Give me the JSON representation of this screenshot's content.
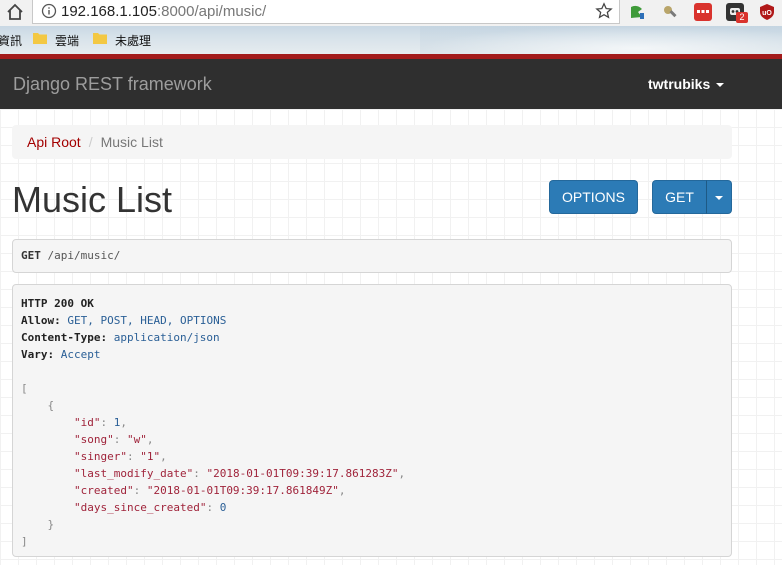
{
  "browser": {
    "url_host": "192.168.1.105",
    "url_rest": ":8000/api/music/",
    "extension_badge": "2",
    "bookmarks": [
      {
        "label": "資訊"
      },
      {
        "label": "雲端"
      },
      {
        "label": "未處理"
      }
    ]
  },
  "navbar": {
    "brand": "Django REST framework",
    "user": "twtrubiks"
  },
  "breadcrumb": {
    "root": "Api Root",
    "separator": "/",
    "current": "Music List"
  },
  "page": {
    "title": "Music List",
    "options_label": "OPTIONS",
    "get_label": "GET"
  },
  "request": {
    "method": "GET",
    "path": "/api/music/"
  },
  "response": {
    "status": "HTTP 200 OK",
    "headers": [
      {
        "key": "Allow:",
        "value": "GET, POST, HEAD, OPTIONS"
      },
      {
        "key": "Content-Type:",
        "value": "application/json"
      },
      {
        "key": "Vary:",
        "value": "Accept"
      }
    ],
    "body": {
      "open_bracket": "[",
      "open_brace": "{",
      "fields": [
        {
          "key": "\"id\"",
          "value": "1",
          "type": "num",
          "comma": ","
        },
        {
          "key": "\"song\"",
          "value": "\"w\"",
          "type": "str",
          "comma": ","
        },
        {
          "key": "\"singer\"",
          "value": "\"1\"",
          "type": "str",
          "comma": ","
        },
        {
          "key": "\"last_modify_date\"",
          "value": "\"2018-01-01T09:39:17.861283Z\"",
          "type": "str",
          "comma": ","
        },
        {
          "key": "\"created\"",
          "value": "\"2018-01-01T09:39:17.861849Z\"",
          "type": "str",
          "comma": ","
        },
        {
          "key": "\"days_since_created\"",
          "value": "0",
          "type": "num",
          "comma": ""
        }
      ],
      "close_brace": "}",
      "close_bracket": "]"
    }
  },
  "colors": {
    "navbar": "#2f2f2f",
    "accent_blue": "#2c7bb6",
    "link_red": "#a30000",
    "browser_redline": "#a31b1b"
  }
}
